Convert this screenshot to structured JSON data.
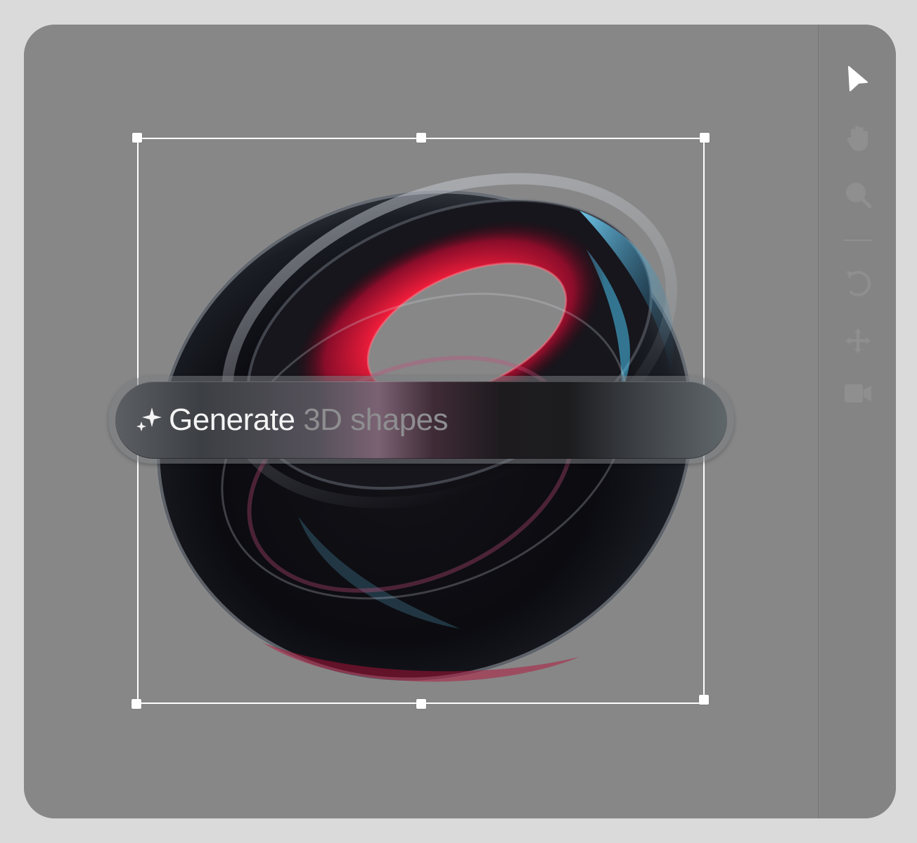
{
  "prompt": {
    "lead": "Generate",
    "trail": "3D shapes",
    "sparkle_icon": "sparkle-icon"
  },
  "toolbar": {
    "tools": [
      {
        "name": "select-tool",
        "icon": "cursor-arrow-icon",
        "active": true
      },
      {
        "name": "pan-tool",
        "icon": "hand-icon",
        "active": false
      },
      {
        "name": "zoom-tool",
        "icon": "magnifier-icon",
        "active": false
      },
      {
        "name": "undo-tool",
        "icon": "undo-icon",
        "active": false
      },
      {
        "name": "move-tool",
        "icon": "move-arrows-icon",
        "active": false
      },
      {
        "name": "camera-tool",
        "icon": "video-camera-icon",
        "active": false
      }
    ]
  },
  "colors": {
    "canvas_bg": "#878787",
    "selection_stroke": "#ffffff",
    "active_tool": "#ffffff",
    "inactive_tool": "#8f8f8f",
    "torus_accent_red": "#ff1f3d",
    "torus_accent_blue": "#3fb6e6"
  }
}
